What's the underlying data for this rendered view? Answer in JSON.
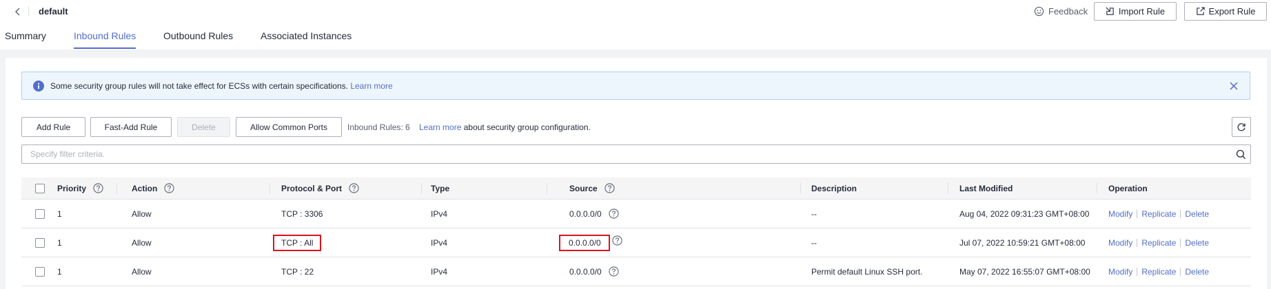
{
  "header": {
    "title": "default",
    "feedback_label": "Feedback",
    "import_label": "Import Rule",
    "export_label": "Export Rule"
  },
  "tabs": [
    {
      "label": "Summary"
    },
    {
      "label": "Inbound Rules"
    },
    {
      "label": "Outbound Rules"
    },
    {
      "label": "Associated Instances"
    }
  ],
  "banner": {
    "message": "Some security group rules will not take effect for ECSs with certain specifications.",
    "link": "Learn more"
  },
  "toolbar": {
    "add_rule": "Add Rule",
    "fast_add_rule": "Fast-Add Rule",
    "delete": "Delete",
    "allow_common_ports": "Allow Common Ports",
    "rule_count": "Inbound Rules: 6",
    "learn_more": "Learn more",
    "about": "about security group configuration."
  },
  "filter": {
    "placeholder": "Specify filter criteria."
  },
  "table": {
    "headers": {
      "priority": "Priority",
      "action": "Action",
      "protocol_port": "Protocol & Port",
      "type": "Type",
      "source": "Source",
      "description": "Description",
      "last_modified": "Last Modified",
      "operation": "Operation"
    },
    "rows": [
      {
        "priority": "1",
        "action": "Allow",
        "protocol_port": "TCP : 3306",
        "type": "IPv4",
        "source": "0.0.0.0/0",
        "description": "--",
        "last_modified": "Aug 04, 2022 09:31:23 GMT+08:00",
        "op_modify": "Modify",
        "op_replicate": "Replicate",
        "op_delete": "Delete"
      },
      {
        "priority": "1",
        "action": "Allow",
        "protocol_port": "TCP : All",
        "type": "IPv4",
        "source": "0.0.0.0/0",
        "description": "--",
        "last_modified": "Jul 07, 2022 10:59:21 GMT+08:00",
        "op_modify": "Modify",
        "op_replicate": "Replicate",
        "op_delete": "Delete"
      },
      {
        "priority": "1",
        "action": "Allow",
        "protocol_port": "TCP : 22",
        "type": "IPv4",
        "source": "0.0.0.0/0",
        "description": "Permit default Linux SSH port.",
        "last_modified": "May 07, 2022 16:55:07 GMT+08:00",
        "op_modify": "Modify",
        "op_replicate": "Replicate",
        "op_delete": "Delete"
      }
    ]
  },
  "colors": {
    "accent": "#526ecc",
    "highlight": "#e0121a",
    "banner_bg": "#eef6fd"
  }
}
